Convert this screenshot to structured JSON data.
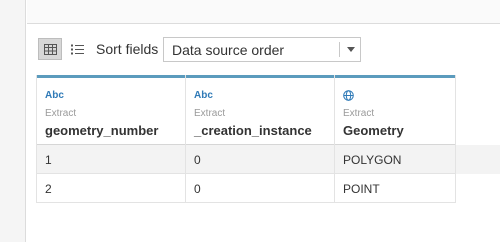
{
  "toolbar": {
    "sort_label": "Sort fields",
    "sort_value": "Data source order",
    "views": [
      "grid-view",
      "list-view"
    ]
  },
  "columns": [
    {
      "type_label": "Abc",
      "source": "Extract",
      "name": "geometry_number"
    },
    {
      "type_label": "Abc",
      "source": "Extract",
      "name": "_creation_instance"
    },
    {
      "type_icon": "globe-icon",
      "source": "Extract",
      "name": "Geometry"
    }
  ],
  "rows": [
    [
      "1",
      "0",
      "POLYGON"
    ],
    [
      "2",
      "0",
      "POINT"
    ]
  ],
  "colors": {
    "header_accent": "#5b9bbd",
    "type_icon": "#2f7ab7"
  }
}
